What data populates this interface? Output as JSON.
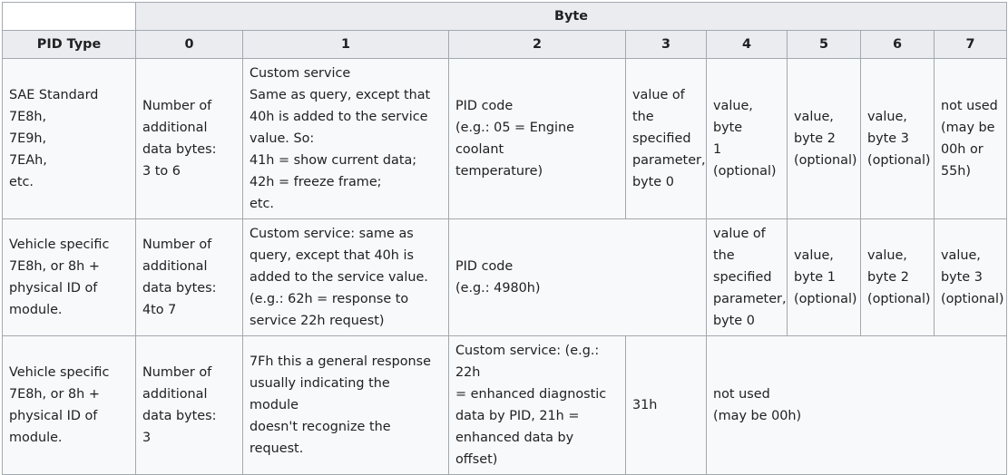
{
  "table": {
    "group_header": "Byte",
    "columns": [
      "PID Type",
      "0",
      "1",
      "2",
      "3",
      "4",
      "5",
      "6",
      "7"
    ],
    "rows": [
      {
        "pid_type": [
          "SAE Standard",
          "7E8h,",
          "7E9h,",
          "7EAh,",
          "etc."
        ],
        "b0": [
          "Number of",
          "additional",
          "data bytes:",
          "3 to 6"
        ],
        "b1": [
          "Custom service",
          "Same as query, except that",
          "40h is added to the service",
          "value. So:",
          "41h = show current data;",
          "42h = freeze frame;",
          "etc."
        ],
        "b2": [
          "PID code",
          "(e.g.: 05 = Engine coolant",
          "temperature)"
        ],
        "b3": [
          "value of",
          "the",
          "specified",
          "parameter,",
          "byte 0"
        ],
        "b4": [
          "value, byte",
          "1",
          "(optional)"
        ],
        "b5": [
          "value,",
          "byte 2",
          "(optional)"
        ],
        "b6": [
          "value,",
          "byte 3",
          "(optional)"
        ],
        "b7": [
          "not used",
          "(may be",
          "00h or",
          "55h)"
        ]
      },
      {
        "pid_type": [
          "Vehicle specific",
          "7E8h, or 8h +",
          "physical ID of",
          "module."
        ],
        "b0": [
          "Number of",
          "additional",
          "data bytes:",
          "4to 7"
        ],
        "b1": [
          "Custom service: same as",
          "query, except that 40h is",
          "added to the service value.",
          "(e.g.: 62h = response to",
          "service 22h request)"
        ],
        "b2_3": [
          "PID code",
          "(e.g.: 4980h)"
        ],
        "b4": [
          "value of",
          "the",
          "specified",
          "parameter,",
          "byte 0"
        ],
        "b5": [
          "value,",
          "byte 1",
          "(optional)"
        ],
        "b6": [
          "value,",
          "byte 2",
          "(optional)"
        ],
        "b7": [
          "value,",
          "byte 3",
          "(optional)"
        ]
      },
      {
        "pid_type": [
          "Vehicle specific",
          "7E8h, or 8h +",
          "physical ID of",
          "module."
        ],
        "b0": [
          "Number of",
          "additional",
          "data bytes:",
          "3"
        ],
        "b1": [
          "7Fh this a general response",
          "usually indicating the module",
          "doesn't recognize the request."
        ],
        "b2": [
          "Custom service: (e.g.: 22h",
          "= enhanced diagnostic",
          "data by PID, 21h =",
          "enhanced data by offset)"
        ],
        "b3": [
          "31h"
        ],
        "b4_7": [
          "not used",
          "(may be 00h)"
        ]
      }
    ]
  }
}
